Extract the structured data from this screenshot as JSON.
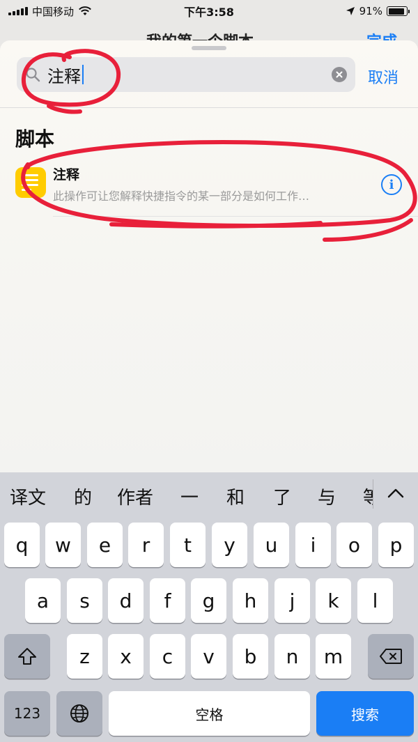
{
  "status_bar": {
    "carrier": "中国移动",
    "time": "下午3:58",
    "battery": "91%",
    "battery_level": 0.91
  },
  "behind_header": {
    "title": "我的第一个脚本",
    "done": "完成"
  },
  "search": {
    "query": "注释",
    "cancel": "取消"
  },
  "results": {
    "section_title": "脚本",
    "items": [
      {
        "title": "注释",
        "description": "此操作可让您解释快捷指令的某一部分是如何工作…",
        "icon": "note-icon"
      }
    ]
  },
  "keyboard": {
    "candidates": [
      "译文",
      "的",
      "作者",
      "一",
      "和",
      "了",
      "与",
      "等"
    ],
    "row1": [
      "q",
      "w",
      "e",
      "r",
      "t",
      "y",
      "u",
      "i",
      "o",
      "p"
    ],
    "row2": [
      "a",
      "s",
      "d",
      "f",
      "g",
      "h",
      "j",
      "k",
      "l"
    ],
    "row3": [
      "z",
      "x",
      "c",
      "v",
      "b",
      "n",
      "m"
    ],
    "numbers_key": "123",
    "space_key": "空格",
    "search_key": "搜索"
  },
  "colors": {
    "accent": "#1a7ef5",
    "annotation": "#e8203a",
    "icon_yellow": "#ffcc00"
  }
}
